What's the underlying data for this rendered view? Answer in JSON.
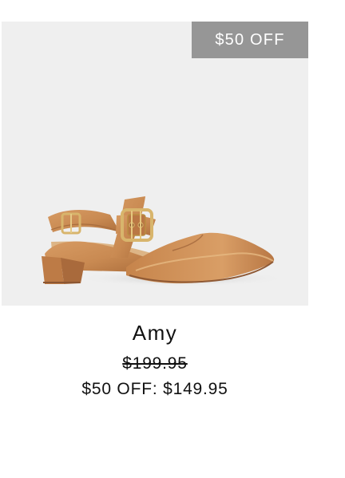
{
  "product": {
    "badge": "$50 OFF",
    "name": "Amy",
    "original_price": "$199.95",
    "sale_prefix": "$50 OFF:",
    "sale_price": "$149.95"
  },
  "icons": {
    "product_image": "tan-leather-slingback-flat-shoe"
  },
  "colors": {
    "image_background": "#efefef",
    "badge_background": "#969696",
    "badge_text": "#ffffff",
    "leather": "#c98a52",
    "buckle": "#d8b56c",
    "text": "#111111"
  }
}
